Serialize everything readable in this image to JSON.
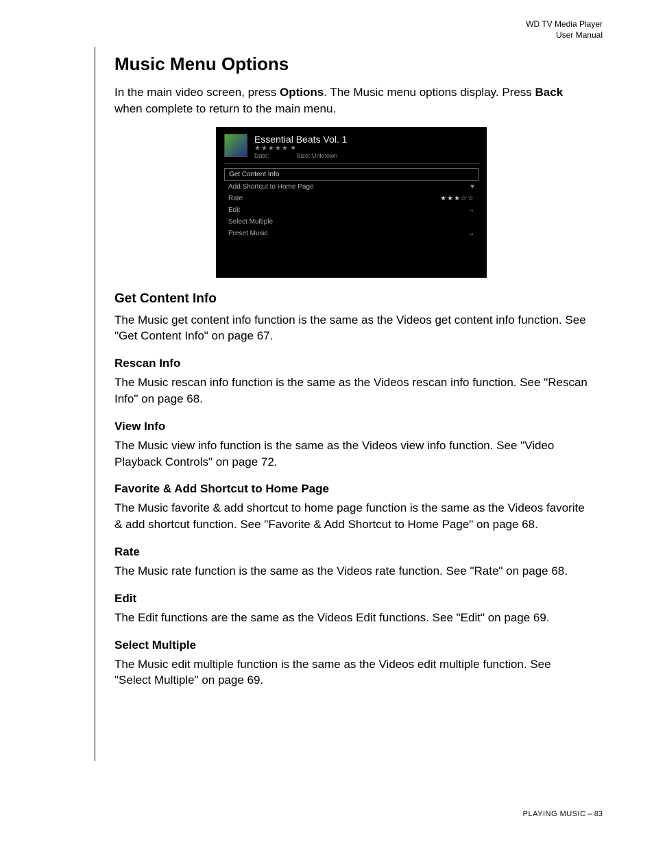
{
  "header": {
    "line1": "WD TV Media Player",
    "line2": "User Manual"
  },
  "page": {
    "title": "Music Menu Options",
    "intro_pre": "In the main video screen, press ",
    "intro_strong1": "Options",
    "intro_mid": ". The Music menu options display. Press ",
    "intro_strong2": "Back",
    "intro_post": " when complete to return to the main menu."
  },
  "screenshot": {
    "title": "Essential Beats Vol. 1",
    "stars_header": "★★★★★ ♥",
    "date_label": "Date:",
    "size_label": "Size: Unknown",
    "rows": {
      "get_content_info": "Get Content Info",
      "add_shortcut": "Add Shortcut to Home Page",
      "rate": "Rate",
      "rate_stars": "★★★☆☆",
      "edit": "Edit",
      "select_multiple": "Select Multiple",
      "preset_music": "Preset Music"
    }
  },
  "sections": {
    "get_content_info": {
      "heading": "Get Content Info",
      "body": "The Music get content info function is the same as the Videos get content info function. See \"Get Content Info\" on page 67."
    },
    "rescan_info": {
      "heading": "Rescan Info",
      "body": "The Music rescan info function is the same as the Videos rescan info function. See \"Rescan Info\" on page 68."
    },
    "view_info": {
      "heading": "View Info",
      "body": "The Music view info function is the same as the Videos view info function. See \"Video Playback Controls\" on page 72."
    },
    "favorite": {
      "heading": "Favorite & Add Shortcut to Home Page",
      "body": "The Music favorite & add shortcut to home page function is the same as the Videos favorite & add shortcut function. See \"Favorite & Add Shortcut to Home Page\" on page 68."
    },
    "rate": {
      "heading": "Rate",
      "body": "The Music rate function is the same as the Videos rate function. See \"Rate\" on page 68."
    },
    "edit": {
      "heading": "Edit",
      "body": "The Edit functions are the same as the Videos Edit functions. See \"Edit\" on page 69."
    },
    "select_multiple": {
      "heading": "Select Multiple",
      "body": "The Music edit multiple function is the same as the Videos edit multiple function. See \"Select Multiple\" on page 69."
    }
  },
  "footer": {
    "section": "PLAYING MUSIC",
    "separator": " – ",
    "page_number": "83"
  }
}
